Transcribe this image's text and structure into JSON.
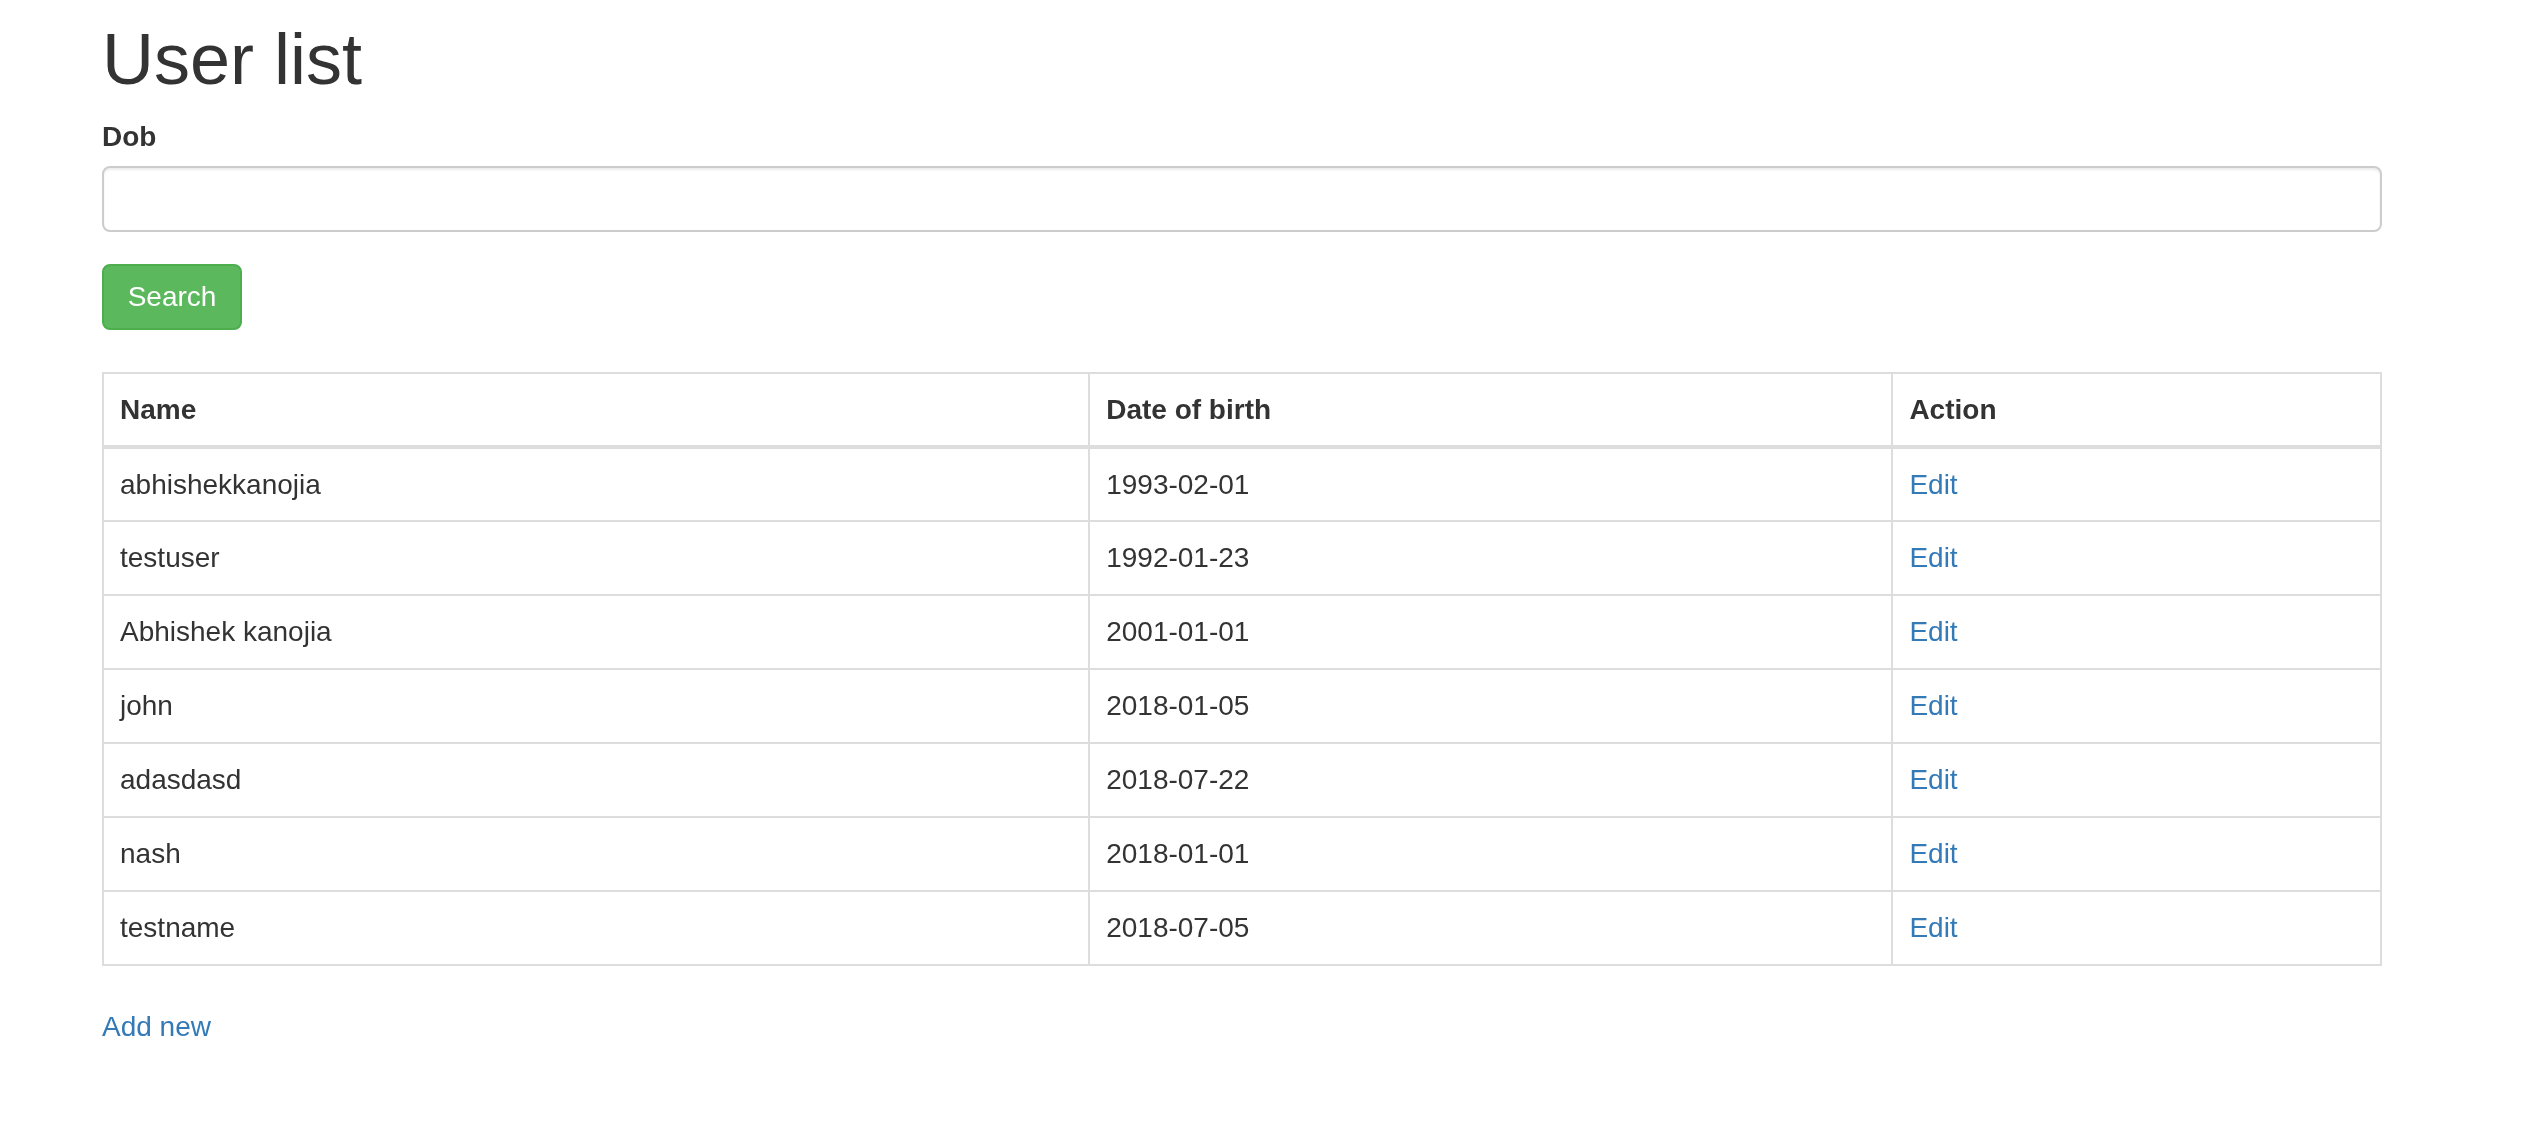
{
  "title": "User list",
  "filter": {
    "label": "Dob"
  },
  "search_button": "Search",
  "table": {
    "columns": [
      "Name",
      "Date of birth",
      "Action"
    ],
    "rows": [
      {
        "name": "abhishekkanojia",
        "dob": "1993-02-01",
        "action": "Edit"
      },
      {
        "name": "testuser",
        "dob": "1992-01-23",
        "action": "Edit"
      },
      {
        "name": "Abhishek kanojia",
        "dob": "2001-01-01",
        "action": "Edit"
      },
      {
        "name": "john",
        "dob": "2018-01-05",
        "action": "Edit"
      },
      {
        "name": "adasdasd",
        "dob": "2018-07-22",
        "action": "Edit"
      },
      {
        "name": "nash",
        "dob": "2018-01-01",
        "action": "Edit"
      },
      {
        "name": "testname",
        "dob": "2018-07-05",
        "action": "Edit"
      }
    ]
  },
  "add_link": "Add new"
}
